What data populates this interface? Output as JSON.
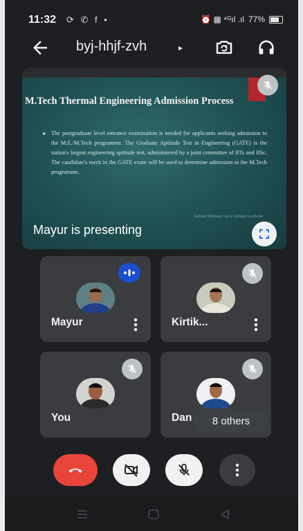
{
  "status_bar": {
    "time": "11:32",
    "left_icons": "⟳ ✆ f •",
    "right_text": "⏰ ▦ ⁴ᴳıl .ıl",
    "battery": "77%"
  },
  "top_bar": {
    "meeting_code": "byj-hhjf-zvh",
    "caret": "▸"
  },
  "presentation": {
    "slide_title": "M.Tech Thermal Engineering Admission Process",
    "slide_body": "The postgraduate level entrance examination is needed for applicants seeking admission to the M.E./M.Tech programme. The Graduate Aptitude Test in Engineering (GATE) is the nation's largest engineering aptitude test, administered by a joint committee of IITs and IISc. The candidate's merit in the GATE exam will be used to determine admission to the M.Tech programme.",
    "watermark": "Activate Windows / Go to Settings to activate",
    "label": "Mayur is presenting"
  },
  "participants": [
    {
      "name": "Mayur",
      "status": "speaking"
    },
    {
      "name": "Kirtik...",
      "status": "muted"
    },
    {
      "name": "You",
      "status": "muted"
    },
    {
      "name": "Dan",
      "status": "muted"
    }
  ],
  "others_label": "8 others",
  "colors": {
    "end_call": "#e8443a",
    "speaking": "#1a4fd0",
    "tile": "#3a3c40",
    "background": "#1e1f22"
  }
}
